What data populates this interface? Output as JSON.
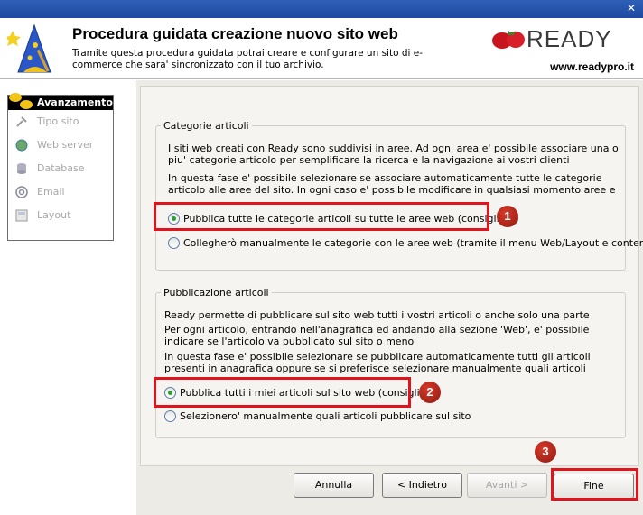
{
  "header": {
    "title": "Procedura guidata creazione nuovo sito web",
    "description": "Tramite questa procedura guidata potrai creare e configurare un sito di e-commerce che sara' sincronizzato con il tuo archivio.",
    "brand": "READY",
    "brand_url": "www.readypro.it"
  },
  "steps": {
    "heading": "Avanzamento",
    "items": [
      {
        "label": "Tipo sito",
        "icon": "tool-icon"
      },
      {
        "label": "Web server",
        "icon": "globe-icon"
      },
      {
        "label": "Database",
        "icon": "database-icon"
      },
      {
        "label": "Email",
        "icon": "at-icon"
      },
      {
        "label": "Layout",
        "icon": "layout-icon"
      }
    ]
  },
  "categories": {
    "legend": "Categorie articoli",
    "text1": "I siti web creati con Ready sono suddivisi in aree. Ad ogni area e' possibile associare una o piu' categorie articolo per semplificare la ricerca e la navigazione ai vostri clienti",
    "text2": "In questa fase e' possibile selezionare se associare automaticamente tutte le categorie articolo alle aree del sito. In ogni caso e' possibile modificare in qualsiasi momento aree e categorie",
    "option1": "Pubblica tutte le categorie articoli su tutte le aree web (consigliato)",
    "option2": "Collegherò manualmente le categorie con le aree web (tramite il menu Web/Layout e contenuti)"
  },
  "publishing": {
    "legend": "Pubblicazione articoli",
    "text1": "Ready permette di pubblicare sul sito web tutti i vostri articoli o anche solo una parte",
    "text2": "Per ogni articolo, entrando nell'anagrafica ed andando alla sezione 'Web', e' possibile indicare se l'articolo va pubblicato sul sito o meno",
    "text3": "In questa fase e' possibile selezionare se pubblicare automaticamente tutti gli articoli presenti in anagrafica oppure se si preferisce selezionare manualmente quali articoli pubblicare",
    "option1": "Pubblica tutti i miei articoli sul sito web (consigliato)",
    "option2": "Selezionero' manualmente quali articoli pubblicare sul sito"
  },
  "badges": [
    "1",
    "2",
    "3"
  ],
  "buttons": {
    "cancel": "Annulla",
    "back": "< Indietro",
    "next": "Avanti >",
    "finish": "Fine"
  },
  "colors": {
    "highlight": "#e0141c",
    "badge": "#b3261c",
    "titlebar": "#2452a8"
  }
}
